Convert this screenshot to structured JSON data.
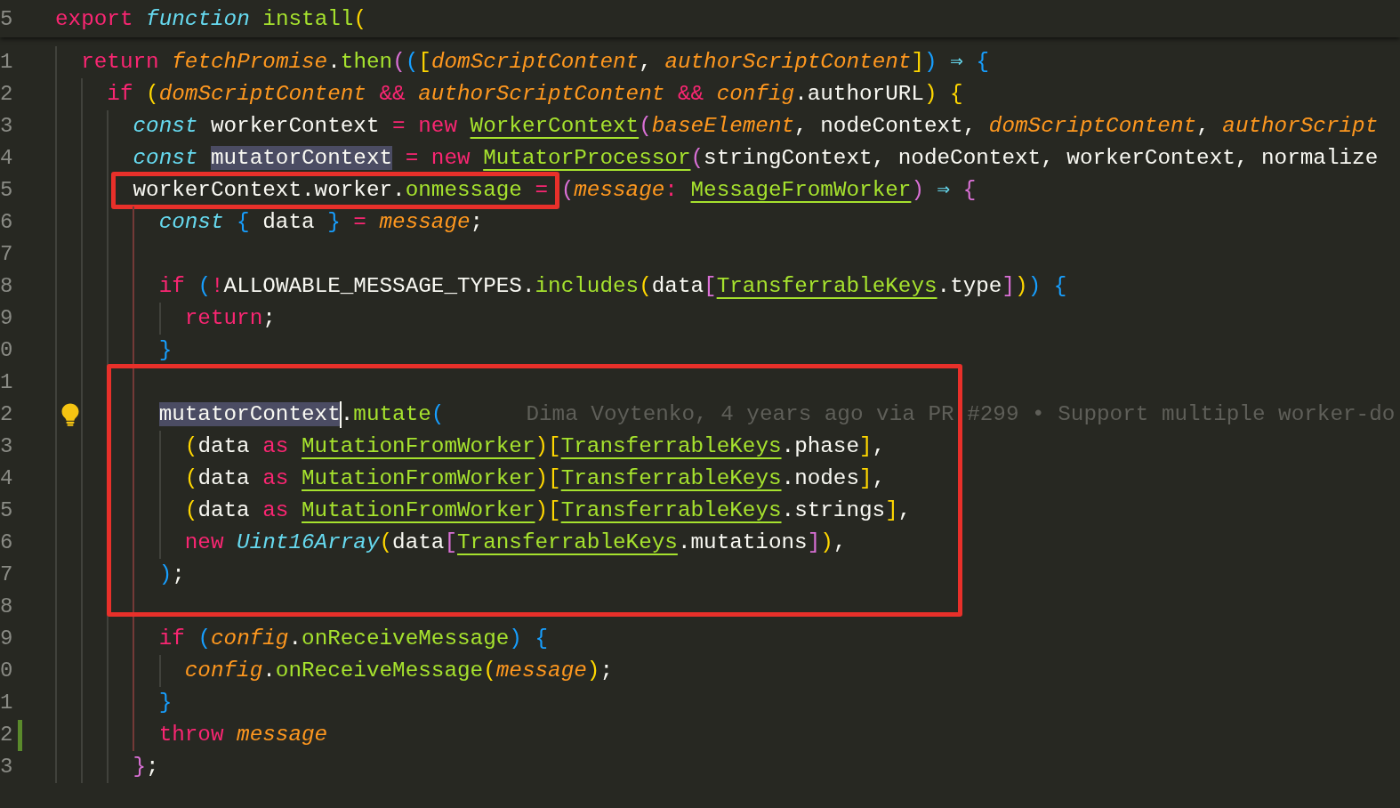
{
  "editor": {
    "sticky_line": {
      "number": "5",
      "tokens": [
        {
          "text": "export ",
          "kind": "keyword"
        },
        {
          "text": "function ",
          "kind": "storage"
        },
        {
          "text": "install",
          "kind": "func"
        },
        {
          "text": "(",
          "kind": "bracket",
          "color": "#ffd700"
        }
      ],
      "children": [
        {
          "number": "1",
          "changed": false,
          "lightbulb": false,
          "active_guide": false,
          "tokens": [
            {
              "text": "return ",
              "kind": "keyword"
            },
            {
              "text": "fetchPromise",
              "kind": "param"
            },
            {
              "text": ".",
              "kind": "plain"
            },
            {
              "text": "then",
              "kind": "func"
            },
            {
              "text": "(",
              "kind": "bracket",
              "color": "#da70d6"
            },
            {
              "text": "(",
              "kind": "bracket",
              "color": "#179fff"
            },
            {
              "text": "[",
              "kind": "bracket",
              "color": "#ffd700"
            },
            {
              "text": "domScriptContent",
              "kind": "param"
            },
            {
              "text": ", ",
              "kind": "plain"
            },
            {
              "text": "authorScriptContent",
              "kind": "param"
            },
            {
              "text": "]",
              "kind": "bracket",
              "color": "#ffd700"
            },
            {
              "text": ")",
              "kind": "bracket",
              "color": "#179fff"
            },
            {
              "text": " ⇒ ",
              "kind": "arrow"
            },
            {
              "text": "{",
              "kind": "bracket",
              "color": "#179fff"
            }
          ],
          "children": [
            {
              "number": "2",
              "changed": false,
              "lightbulb": false,
              "active_guide": false,
              "tokens": [
                {
                  "text": "if ",
                  "kind": "keyword"
                },
                {
                  "text": "(",
                  "kind": "bracket",
                  "color": "#ffd700"
                },
                {
                  "text": "domScriptContent",
                  "kind": "param"
                },
                {
                  "text": " && ",
                  "kind": "keyword"
                },
                {
                  "text": "authorScriptContent",
                  "kind": "param"
                },
                {
                  "text": " && ",
                  "kind": "keyword"
                },
                {
                  "text": "config",
                  "kind": "param"
                },
                {
                  "text": ".authorURL",
                  "kind": "plain"
                },
                {
                  "text": ")",
                  "kind": "bracket",
                  "color": "#ffd700"
                },
                {
                  "text": " {",
                  "kind": "bracket",
                  "color": "#ffd700"
                }
              ],
              "children": [
                {
                  "number": "3",
                  "changed": false,
                  "lightbulb": false,
                  "active_guide": false,
                  "tokens": [
                    {
                      "text": "const",
                      "kind": "storage"
                    },
                    {
                      "text": " workerContext ",
                      "kind": "plain"
                    },
                    {
                      "text": "= new ",
                      "kind": "keyword"
                    },
                    {
                      "text": "WorkerContext",
                      "kind": "type"
                    },
                    {
                      "text": "(",
                      "kind": "bracket",
                      "color": "#da70d6"
                    },
                    {
                      "text": "baseElement",
                      "kind": "param"
                    },
                    {
                      "text": ", nodeContext, ",
                      "kind": "plain"
                    },
                    {
                      "text": "domScriptContent",
                      "kind": "param"
                    },
                    {
                      "text": ", ",
                      "kind": "plain"
                    },
                    {
                      "text": "authorScript",
                      "kind": "param"
                    }
                  ]
                },
                {
                  "number": "4",
                  "changed": false,
                  "lightbulb": false,
                  "active_guide": false,
                  "tokens": [
                    {
                      "text": "const ",
                      "kind": "storage"
                    },
                    {
                      "text": "mutatorContext",
                      "kind": "highlight"
                    },
                    {
                      "text": " = new ",
                      "kind": "keyword"
                    },
                    {
                      "text": "MutatorProcessor",
                      "kind": "type"
                    },
                    {
                      "text": "(",
                      "kind": "bracket",
                      "color": "#da70d6"
                    },
                    {
                      "text": "stringContext, nodeContext, workerContext, normalize",
                      "kind": "plain"
                    }
                  ]
                },
                {
                  "number": "5",
                  "changed": false,
                  "lightbulb": false,
                  "active_guide": true,
                  "tokens": [
                    {
                      "kind": "frame",
                      "tokens": [
                        {
                          "text": "workerContext.worker.",
                          "kind": "plain"
                        },
                        {
                          "text": "onmessage",
                          "kind": "func"
                        },
                        {
                          "text": " =",
                          "kind": "keyword"
                        }
                      ]
                    },
                    {
                      "text": "(",
                      "kind": "bracket",
                      "color": "#da70d6"
                    },
                    {
                      "text": "message",
                      "kind": "param"
                    },
                    {
                      "text": ": ",
                      "kind": "keyword"
                    },
                    {
                      "text": "MessageFromWorker",
                      "kind": "type"
                    },
                    {
                      "text": ")",
                      "kind": "bracket",
                      "color": "#da70d6"
                    },
                    {
                      "text": " ⇒ ",
                      "kind": "arrow"
                    },
                    {
                      "text": "{",
                      "kind": "bracket",
                      "color": "#da70d6"
                    }
                  ],
                  "children": [
                    {
                      "number": "6",
                      "changed": false,
                      "lightbulb": false,
                      "active_guide": false,
                      "tokens": [
                        {
                          "text": "const ",
                          "kind": "storage"
                        },
                        {
                          "text": "{",
                          "kind": "bracket",
                          "color": "#179fff"
                        },
                        {
                          "text": " data ",
                          "kind": "plain"
                        },
                        {
                          "text": "}",
                          "kind": "bracket",
                          "color": "#179fff"
                        },
                        {
                          "text": " = ",
                          "kind": "keyword"
                        },
                        {
                          "text": "message",
                          "kind": "param"
                        },
                        {
                          "text": ";",
                          "kind": "plain"
                        }
                      ]
                    },
                    {
                      "number": "7",
                      "changed": false,
                      "lightbulb": false,
                      "active_guide": false
                    },
                    {
                      "number": "8",
                      "changed": false,
                      "lightbulb": false,
                      "active_guide": false,
                      "tokens": [
                        {
                          "text": "if ",
                          "kind": "keyword"
                        },
                        {
                          "text": "(",
                          "kind": "bracket",
                          "color": "#179fff"
                        },
                        {
                          "text": "!",
                          "kind": "keyword"
                        },
                        {
                          "text": "ALLOWABLE_MESSAGE_TYPES.",
                          "kind": "plain"
                        },
                        {
                          "text": "includes",
                          "kind": "func"
                        },
                        {
                          "text": "(",
                          "kind": "bracket",
                          "color": "#ffd700"
                        },
                        {
                          "text": "data",
                          "kind": "plain"
                        },
                        {
                          "text": "[",
                          "kind": "bracket",
                          "color": "#da70d6"
                        },
                        {
                          "text": "TransferrableKeys",
                          "kind": "type"
                        },
                        {
                          "text": ".type",
                          "kind": "plain"
                        },
                        {
                          "text": "]",
                          "kind": "bracket",
                          "color": "#da70d6"
                        },
                        {
                          "text": ")",
                          "kind": "bracket",
                          "color": "#ffd700"
                        },
                        {
                          "text": ")",
                          "kind": "bracket",
                          "color": "#179fff"
                        },
                        {
                          "text": " {",
                          "kind": "bracket",
                          "color": "#179fff"
                        }
                      ],
                      "children": [
                        {
                          "number": "9",
                          "changed": false,
                          "lightbulb": false,
                          "active_guide": false,
                          "tokens": [
                            {
                              "text": "return",
                              "kind": "keyword"
                            },
                            {
                              "text": ";",
                              "kind": "plain"
                            }
                          ]
                        }
                      ]
                    },
                    {
                      "number": "0",
                      "changed": false,
                      "lightbulb": false,
                      "active_guide": false,
                      "tokens": [
                        {
                          "text": "}",
                          "kind": "bracket",
                          "color": "#179fff"
                        }
                      ]
                    },
                    {
                      "number": "1",
                      "changed": false,
                      "lightbulb": false,
                      "active_guide": false
                    },
                    {
                      "number": "2",
                      "changed": false,
                      "lightbulb": true,
                      "active_guide": false,
                      "tokens": [
                        {
                          "text": "mutatorContext",
                          "kind": "highlight"
                        },
                        {
                          "kind": "cursor"
                        },
                        {
                          "text": ".",
                          "kind": "plain"
                        },
                        {
                          "text": "mutate",
                          "kind": "func"
                        },
                        {
                          "text": "(",
                          "kind": "bracket",
                          "color": "#179fff"
                        }
                      ],
                      "blame": "Dima Voytenko, 4 years ago via PR #299 • Support multiple worker-do",
                      "children": [
                        {
                          "number": "3",
                          "changed": false,
                          "lightbulb": false,
                          "active_guide": false,
                          "tokens": [
                            {
                              "text": "(",
                              "kind": "bracket",
                              "color": "#ffd700"
                            },
                            {
                              "text": "data ",
                              "kind": "plain"
                            },
                            {
                              "text": "as ",
                              "kind": "keyword"
                            },
                            {
                              "text": "MutationFromWorker",
                              "kind": "type"
                            },
                            {
                              "text": ")",
                              "kind": "bracket",
                              "color": "#ffd700"
                            },
                            {
                              "text": "[",
                              "kind": "bracket",
                              "color": "#ffd700"
                            },
                            {
                              "text": "TransferrableKeys",
                              "kind": "type"
                            },
                            {
                              "text": ".phase",
                              "kind": "plain"
                            },
                            {
                              "text": "]",
                              "kind": "bracket",
                              "color": "#ffd700"
                            },
                            {
                              "text": ",",
                              "kind": "plain"
                            }
                          ]
                        },
                        {
                          "number": "4",
                          "changed": false,
                          "lightbulb": false,
                          "active_guide": false,
                          "tokens": [
                            {
                              "text": "(",
                              "kind": "bracket",
                              "color": "#ffd700"
                            },
                            {
                              "text": "data ",
                              "kind": "plain"
                            },
                            {
                              "text": "as ",
                              "kind": "keyword"
                            },
                            {
                              "text": "MutationFromWorker",
                              "kind": "type"
                            },
                            {
                              "text": ")",
                              "kind": "bracket",
                              "color": "#ffd700"
                            },
                            {
                              "text": "[",
                              "kind": "bracket",
                              "color": "#ffd700"
                            },
                            {
                              "text": "TransferrableKeys",
                              "kind": "type"
                            },
                            {
                              "text": ".nodes",
                              "kind": "plain"
                            },
                            {
                              "text": "]",
                              "kind": "bracket",
                              "color": "#ffd700"
                            },
                            {
                              "text": ",",
                              "kind": "plain"
                            }
                          ]
                        },
                        {
                          "number": "5",
                          "changed": false,
                          "lightbulb": false,
                          "active_guide": false,
                          "tokens": [
                            {
                              "text": "(",
                              "kind": "bracket",
                              "color": "#ffd700"
                            },
                            {
                              "text": "data ",
                              "kind": "plain"
                            },
                            {
                              "text": "as ",
                              "kind": "keyword"
                            },
                            {
                              "text": "MutationFromWorker",
                              "kind": "type"
                            },
                            {
                              "text": ")",
                              "kind": "bracket",
                              "color": "#ffd700"
                            },
                            {
                              "text": "[",
                              "kind": "bracket",
                              "color": "#ffd700"
                            },
                            {
                              "text": "TransferrableKeys",
                              "kind": "type"
                            },
                            {
                              "text": ".strings",
                              "kind": "plain"
                            },
                            {
                              "text": "]",
                              "kind": "bracket",
                              "color": "#ffd700"
                            },
                            {
                              "text": ",",
                              "kind": "plain"
                            }
                          ]
                        },
                        {
                          "number": "6",
                          "changed": false,
                          "lightbulb": false,
                          "active_guide": false,
                          "tokens": [
                            {
                              "text": "new ",
                              "kind": "keyword"
                            },
                            {
                              "text": "Uint16Array",
                              "kind": "storage"
                            },
                            {
                              "text": "(",
                              "kind": "bracket",
                              "color": "#ffd700"
                            },
                            {
                              "text": "data",
                              "kind": "plain"
                            },
                            {
                              "text": "[",
                              "kind": "bracket",
                              "color": "#da70d6"
                            },
                            {
                              "text": "TransferrableKeys",
                              "kind": "type"
                            },
                            {
                              "text": ".mutations",
                              "kind": "plain"
                            },
                            {
                              "text": "]",
                              "kind": "bracket",
                              "color": "#da70d6"
                            },
                            {
                              "text": ")",
                              "kind": "bracket",
                              "color": "#ffd700"
                            },
                            {
                              "text": ",",
                              "kind": "plain"
                            }
                          ]
                        }
                      ]
                    },
                    {
                      "number": "7",
                      "changed": false,
                      "lightbulb": false,
                      "active_guide": false,
                      "tokens": [
                        {
                          "text": ")",
                          "kind": "bracket",
                          "color": "#179fff"
                        },
                        {
                          "text": ";",
                          "kind": "plain"
                        }
                      ]
                    },
                    {
                      "number": "8",
                      "changed": false,
                      "lightbulb": false,
                      "active_guide": false
                    },
                    {
                      "number": "9",
                      "changed": false,
                      "lightbulb": false,
                      "active_guide": false,
                      "tokens": [
                        {
                          "text": "if ",
                          "kind": "keyword"
                        },
                        {
                          "text": "(",
                          "kind": "bracket",
                          "color": "#179fff"
                        },
                        {
                          "text": "config",
                          "kind": "param"
                        },
                        {
                          "text": ".",
                          "kind": "plain"
                        },
                        {
                          "text": "onReceiveMessage",
                          "kind": "func"
                        },
                        {
                          "text": ")",
                          "kind": "bracket",
                          "color": "#179fff"
                        },
                        {
                          "text": " {",
                          "kind": "bracket",
                          "color": "#179fff"
                        }
                      ],
                      "children": [
                        {
                          "number": "0",
                          "changed": false,
                          "lightbulb": false,
                          "active_guide": false,
                          "tokens": [
                            {
                              "text": "config",
                              "kind": "param"
                            },
                            {
                              "text": ".",
                              "kind": "plain"
                            },
                            {
                              "text": "onReceiveMessage",
                              "kind": "func"
                            },
                            {
                              "text": "(",
                              "kind": "bracket",
                              "color": "#ffd700"
                            },
                            {
                              "text": "message",
                              "kind": "param"
                            },
                            {
                              "text": ")",
                              "kind": "bracket",
                              "color": "#ffd700"
                            },
                            {
                              "text": ";",
                              "kind": "plain"
                            }
                          ]
                        }
                      ]
                    },
                    {
                      "number": "1",
                      "changed": false,
                      "lightbulb": false,
                      "active_guide": false,
                      "tokens": [
                        {
                          "text": "}",
                          "kind": "bracket",
                          "color": "#179fff"
                        }
                      ]
                    },
                    {
                      "number": "2",
                      "changed": true,
                      "lightbulb": false,
                      "active_guide": false,
                      "tokens": [
                        {
                          "text": "throw ",
                          "kind": "keyword"
                        },
                        {
                          "text": "message",
                          "kind": "param"
                        }
                      ]
                    }
                  ]
                },
                {
                  "number": "3",
                  "changed": false,
                  "lightbulb": false,
                  "active_guide": false,
                  "tokens": [
                    {
                      "text": "}",
                      "kind": "bracket",
                      "color": "#da70d6"
                    },
                    {
                      "text": ";",
                      "kind": "plain"
                    }
                  ]
                }
              ]
            }
          ]
        }
      ]
    }
  },
  "annotations": [
    {
      "kind": "frame"
    }
  ]
}
